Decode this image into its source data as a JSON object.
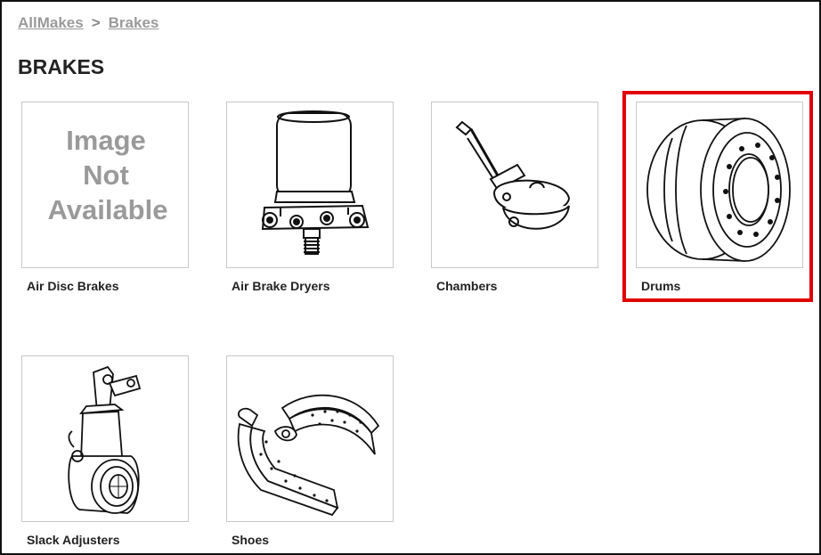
{
  "breadcrumb": {
    "root": "AllMakes",
    "separator": ">",
    "current": "Brakes"
  },
  "page_title": "BRAKES",
  "categories": [
    {
      "label": "Air Disc Brakes",
      "placeholder": [
        "Image",
        "Not",
        "Available"
      ],
      "icon": "image-not-available"
    },
    {
      "label": "Air Brake Dryers",
      "icon": "air-dryer-icon"
    },
    {
      "label": "Chambers",
      "icon": "brake-chamber-icon"
    },
    {
      "label": "Drums",
      "icon": "brake-drum-icon",
      "highlighted": true
    },
    {
      "label": "Slack Adjusters",
      "icon": "slack-adjuster-icon"
    },
    {
      "label": "Shoes",
      "icon": "brake-shoes-icon"
    }
  ],
  "colors": {
    "highlight": "#e00000",
    "breadcrumb": "#9a9a9a",
    "title": "#222222",
    "placeholder_text": "#9a9a9a"
  }
}
